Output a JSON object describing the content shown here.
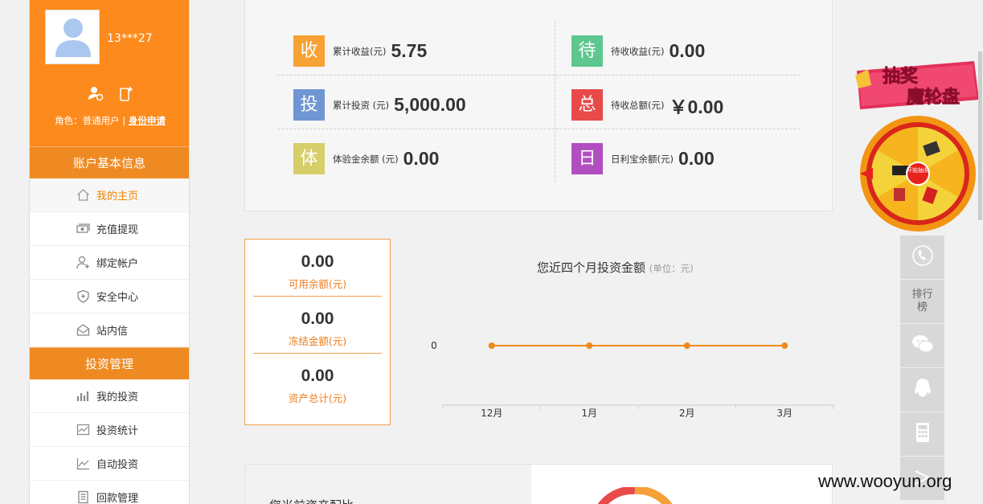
{
  "profile": {
    "username": "13***27",
    "role_text": "角色：普通用户 |",
    "apply_link": "身份申请"
  },
  "sidebar": {
    "section1": "账户基本信息",
    "items1": [
      "我的主页",
      "充值提现",
      "绑定帐户",
      "安全中心",
      "站内信"
    ],
    "section2": "投资管理",
    "items2": [
      "我的投资",
      "投资统计",
      "自动投资",
      "回款管理"
    ]
  },
  "stats": [
    {
      "badge": "收",
      "color": "#f7a233",
      "label": "累计收益(元)",
      "value": "5.75"
    },
    {
      "badge": "待",
      "color": "#5cc78f",
      "label": "待收收益(元)",
      "value": "0.00"
    },
    {
      "badge": "投",
      "color": "#6f96d3",
      "label": "累计投资 (元)",
      "value": "5,000.00"
    },
    {
      "badge": "总",
      "color": "#e84a4a",
      "label": "待收总额(元)",
      "value": "￥0.00"
    },
    {
      "badge": "体",
      "color": "#d6cf69",
      "label": "体验金余额 (元)",
      "value": "0.00"
    },
    {
      "badge": "日",
      "color": "#b24ec1",
      "label": "日利宝余额(元)",
      "value": "0.00"
    }
  ],
  "balance": [
    {
      "value": "0.00",
      "label": "可用余额(元)"
    },
    {
      "value": "0.00",
      "label": "冻结金额(元)"
    },
    {
      "value": "0.00",
      "label": "资产总计(元)"
    }
  ],
  "chart": {
    "title": "您近四个月投资金额",
    "unit": "(单位：元)"
  },
  "chart_data": {
    "type": "line",
    "categories": [
      "12月",
      "1月",
      "2月",
      "3月"
    ],
    "series": [
      {
        "values": [
          0,
          0,
          0,
          0
        ]
      }
    ],
    "yticks": [
      "0"
    ],
    "color": "#f08a1a"
  },
  "bottom": {
    "partial_title": "您当前资产配比"
  },
  "tools": {
    "rank_label": "排行榜",
    "lottery_title1": "抽奖",
    "lottery_title2": "魔轮盘",
    "lottery_center": "开始抽奖"
  },
  "watermark": "www.wooyun.org"
}
